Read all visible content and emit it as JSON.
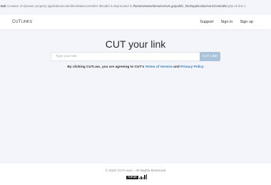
{
  "deprecation": {
    "label": "tcd:",
    "message": " Creation of dynamic property application/controllers/MainController::$model is deprecated in ",
    "path": "/home/u/www/domains/cuts.gu/public_html/application/core/Controller.",
    "rest": "php on line 1"
  },
  "nav": {
    "brand": "CUT",
    "brand_sub": "LINKS",
    "links": [
      "Support",
      "Sign in",
      "Sign up"
    ]
  },
  "hero": {
    "title": "CUT your link"
  },
  "form": {
    "placeholder": "Type your link",
    "button_label": "CUT LINK"
  },
  "agreement": {
    "prefix": "By clicking CUT",
    "prefix_small": "LINK",
    "middle": ", you are agreeing to CUT's ",
    "terms": "Terms of Service",
    "and": " and ",
    "privacy": "Privacy Policy"
  },
  "footer": {
    "copyright_prefix": "© 2022 CUT",
    "copyright_small": "LINKS",
    "copyright_suffix": " - All Rights Reserved",
    "badge": "TOP.GE"
  }
}
